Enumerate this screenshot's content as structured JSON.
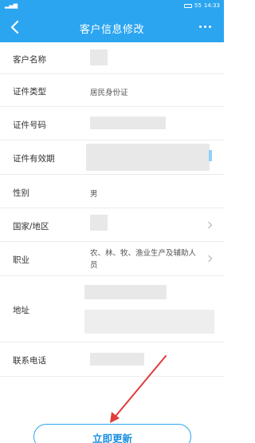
{
  "status_bar": {
    "signal": "▂▄▆",
    "battery": "55",
    "time": "14:33"
  },
  "header": {
    "title": "客户信息修改"
  },
  "fields": {
    "customer_name": {
      "label": "客户名称"
    },
    "id_type": {
      "label": "证件类型",
      "value": "居民身份证"
    },
    "id_number": {
      "label": "证件号码"
    },
    "id_validity": {
      "label": "证件有效期"
    },
    "gender": {
      "label": "性别",
      "value": "男"
    },
    "country": {
      "label": "国家/地区"
    },
    "occupation": {
      "label": "职业",
      "value": "农、林、牧、渔业生产及辅助人员"
    },
    "address": {
      "label": "地址"
    },
    "phone": {
      "label": "联系电话"
    }
  },
  "update_button": {
    "label": "立即更新"
  },
  "colors": {
    "accent": "#2ca5f1",
    "annotation": "#e03c3c"
  }
}
